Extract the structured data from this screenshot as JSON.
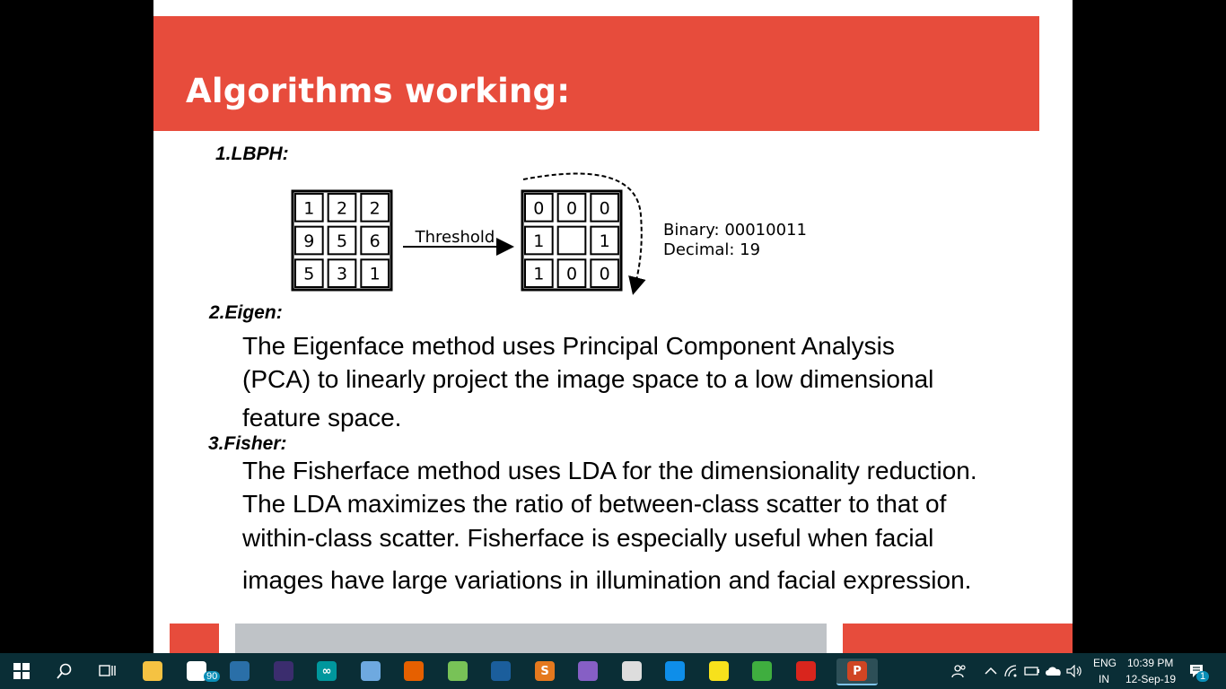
{
  "slide": {
    "title": "Algorithms working:",
    "sections": [
      {
        "heading": "1.LBPH:"
      },
      {
        "heading": "2.Eigen:",
        "lines": [
          "The Eigenface method uses Principal Component Analysis",
          "(PCA) to linearly project the image space to a low dimensional",
          "feature space."
        ]
      },
      {
        "heading": "3.Fisher:",
        "lines": [
          "The Fisherface method uses LDA for the dimensionality reduction.",
          "The LDA maximizes the ratio of between-class scatter to that of",
          "within-class scatter. Fisherface is especially useful when facial",
          "images have large variations in illumination and facial expression."
        ]
      }
    ],
    "diagram": {
      "input_grid": [
        "1",
        "2",
        "2",
        "9",
        "5",
        "6",
        "5",
        "3",
        "1"
      ],
      "arrow_label": "Threshold",
      "output_grid": [
        "0",
        "0",
        "0",
        "1",
        "",
        "1",
        "1",
        "0",
        "0"
      ],
      "binary": "Binary: 00010011",
      "decimal": "Decimal: 19"
    }
  },
  "taskbar": {
    "mail_badge": "90",
    "lang_top": "ENG",
    "lang_bottom": "IN",
    "time": "10:39 PM",
    "date": "12-Sep-19",
    "notification_count": "1",
    "apps": [
      {
        "name": "file-explorer-icon",
        "color": "#f5c242",
        "glyph": ""
      },
      {
        "name": "mail-icon",
        "color": "#ffffff",
        "glyph": ""
      },
      {
        "name": "mysql-workbench-icon",
        "color": "#2a6fa8",
        "glyph": ""
      },
      {
        "name": "eclipse-icon",
        "color": "#3b2d6e",
        "glyph": ""
      },
      {
        "name": "arduino-icon",
        "color": "#00979d",
        "glyph": "∞"
      },
      {
        "name": "3d-box-icon",
        "color": "#6ea9e0",
        "glyph": ""
      },
      {
        "name": "firefox-icon",
        "color": "#e66000",
        "glyph": ""
      },
      {
        "name": "android-studio-icon",
        "color": "#78c257",
        "glyph": ""
      },
      {
        "name": "virtualbox-icon",
        "color": "#1b5e9c",
        "glyph": ""
      },
      {
        "name": "sublime-text-icon",
        "color": "#e5791e",
        "glyph": "S"
      },
      {
        "name": "visual-studio-icon",
        "color": "#865fc5",
        "glyph": ""
      },
      {
        "name": "media-player-icon",
        "color": "#dddddd",
        "glyph": ""
      },
      {
        "name": "teamviewer-icon",
        "color": "#0e8ee9",
        "glyph": ""
      },
      {
        "name": "sticky-notes-icon",
        "color": "#f7e11c",
        "glyph": ""
      },
      {
        "name": "sync-icon",
        "color": "#3fae3f",
        "glyph": ""
      },
      {
        "name": "acrobat-icon",
        "color": "#d9251d",
        "glyph": ""
      },
      {
        "name": "powerpoint-icon",
        "color": "#d04523",
        "glyph": "P"
      }
    ]
  }
}
